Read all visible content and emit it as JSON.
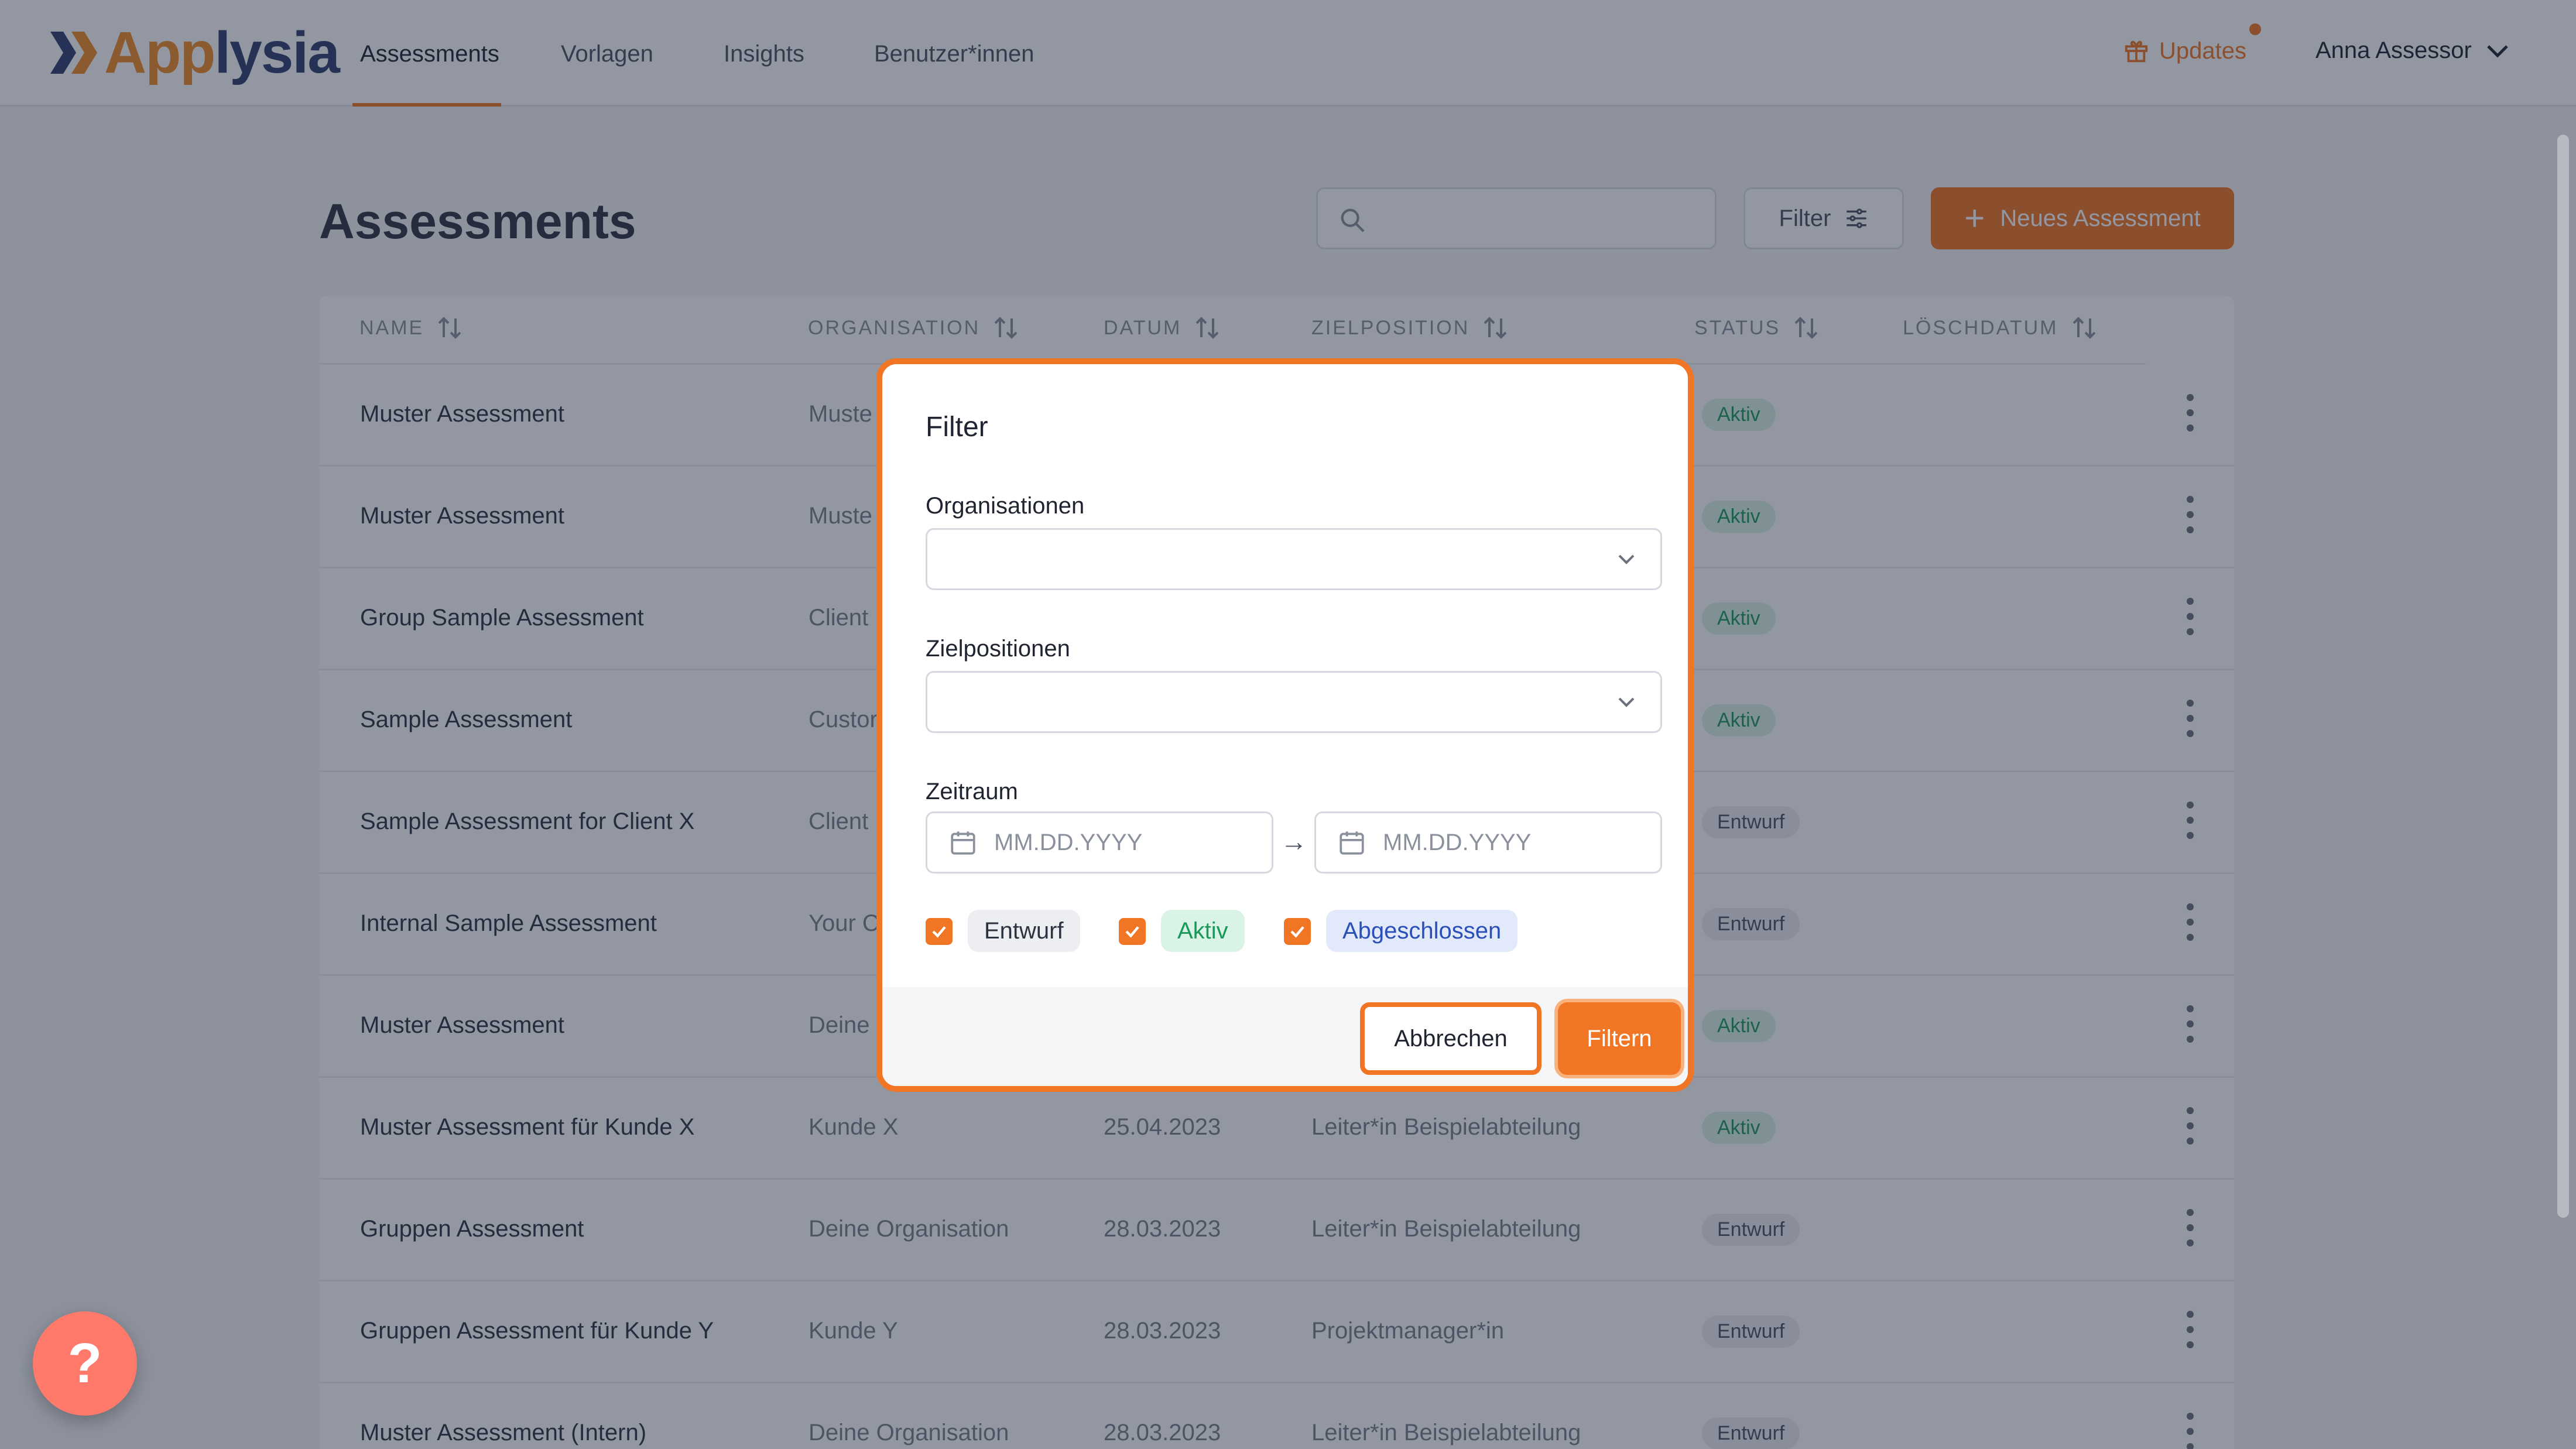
{
  "brand": {
    "name_a": "App",
    "name_b": "lysia"
  },
  "nav": [
    {
      "label": "Assessments"
    },
    {
      "label": "Vorlagen"
    },
    {
      "label": "Insights"
    },
    {
      "label": "Benutzer*innen"
    }
  ],
  "header": {
    "updates_label": "Updates",
    "user_name": "Anna Assessor"
  },
  "page": {
    "title": "Assessments",
    "filter_label": "Filter",
    "new_button_label": "Neues Assessment"
  },
  "table": {
    "columns": [
      "NAME",
      "ORGANISATION",
      "DATUM",
      "ZIELPOSITION",
      "STATUS",
      "LÖSCHDATUM"
    ],
    "rows": [
      {
        "name": "Muster Assessment",
        "org": "Muste",
        "date": "",
        "pos": "",
        "status": "Aktiv"
      },
      {
        "name": "Muster Assessment",
        "org": "Muste",
        "date": "",
        "pos": "",
        "status": "Aktiv"
      },
      {
        "name": "Group Sample Assessment",
        "org": "Client",
        "date": "",
        "pos": "",
        "status": "Aktiv"
      },
      {
        "name": "Sample Assessment",
        "org": "Custor",
        "date": "",
        "pos": "",
        "status": "Aktiv"
      },
      {
        "name": "Sample Assessment for Client X",
        "org": "Client",
        "date": "",
        "pos": "",
        "status": "Entwurf"
      },
      {
        "name": "Internal Sample Assessment",
        "org": "Your C",
        "date": "",
        "pos": "",
        "status": "Entwurf"
      },
      {
        "name": "Muster Assessment",
        "org": "Deine",
        "date": "",
        "pos": "",
        "status": "Aktiv"
      },
      {
        "name": "Muster Assessment für Kunde X",
        "org": "Kunde X",
        "date": "25.04.2023",
        "pos": "Leiter*in Beispielabteilung",
        "status": "Aktiv"
      },
      {
        "name": "Gruppen Assessment",
        "org": "Deine Organisation",
        "date": "28.03.2023",
        "pos": "Leiter*in Beispielabteilung",
        "status": "Entwurf"
      },
      {
        "name": "Gruppen Assessment für Kunde Y",
        "org": "Kunde Y",
        "date": "28.03.2023",
        "pos": "Projektmanager*in",
        "status": "Entwurf"
      },
      {
        "name": "Muster Assessment (Intern)",
        "org": "Deine Organisation",
        "date": "28.03.2023",
        "pos": "Leiter*in Beispielabteilung",
        "status": "Entwurf"
      }
    ]
  },
  "modal": {
    "title": "Filter",
    "organisations_label": "Organisationen",
    "positions_label": "Zielpositionen",
    "period_label": "Zeitraum",
    "date_placeholder_from": "MM.DD.YYYY",
    "date_placeholder_to": "MM.DD.YYYY",
    "arrow": "→",
    "status_options": [
      {
        "label": "Entwurf",
        "checked": true
      },
      {
        "label": "Aktiv",
        "checked": true
      },
      {
        "label": "Abgeschlossen",
        "checked": true
      }
    ],
    "cancel_label": "Abbrechen",
    "submit_label": "Filtern"
  },
  "help": {
    "label": "?"
  },
  "colors": {
    "accent": "#f07524",
    "brand_dark": "#2e3e6e",
    "overlay": "rgba(30,38,58,0.48)"
  }
}
